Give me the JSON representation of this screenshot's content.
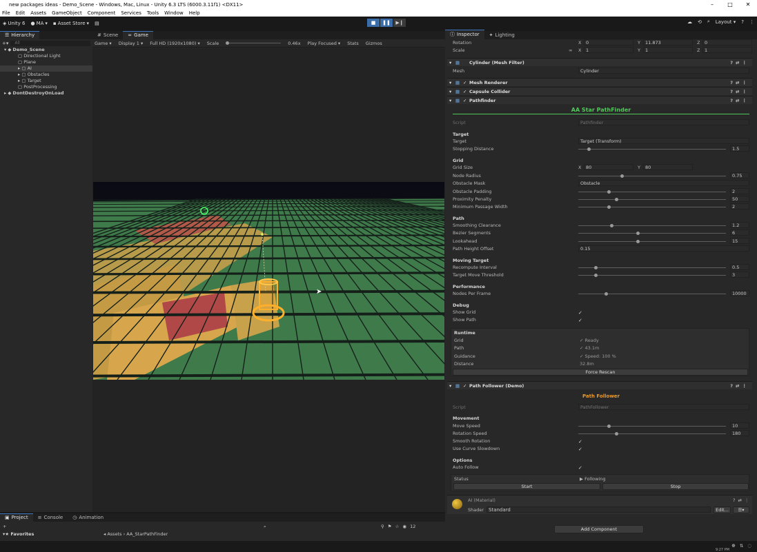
{
  "window": {
    "title": "new packages ideas - Demo_Scene - Windows, Mac, Linux - Unity 6.3 LTS (6000.3.11f1) <DX11>",
    "min": "–",
    "max": "□",
    "close": "✕"
  },
  "menu": [
    "File",
    "Edit",
    "Assets",
    "GameObject",
    "Component",
    "Services",
    "Tools",
    "Window",
    "Help"
  ],
  "toolbar": {
    "unity": "Unity 6",
    "account": "MA",
    "store": "Asset Store",
    "layout": "Layout"
  },
  "hierarchy": {
    "tab": "Hierarchy",
    "search_placeholder": "All",
    "items": [
      {
        "label": "Demo_Scene",
        "depth": 0
      },
      {
        "label": "Directional Light",
        "depth": 2
      },
      {
        "label": "Plane",
        "depth": 2
      },
      {
        "label": "AI",
        "depth": 2
      },
      {
        "label": "Obstacles",
        "depth": 2
      },
      {
        "label": "Target",
        "depth": 2
      },
      {
        "label": "PostProcessing",
        "depth": 2
      },
      {
        "label": "DontDestroyOnLoad",
        "depth": 0
      }
    ]
  },
  "view_tabs": {
    "scene": "Scene",
    "game": "Game"
  },
  "gamebar": {
    "mode": "Game",
    "display": "Display 1",
    "resolution": "Full HD (1920x1080)",
    "scale_label": "Scale",
    "scale_value": "0.46x",
    "play_mode": "Play Focused",
    "stats": "Stats",
    "gizmos": "Gizmos"
  },
  "bottom": {
    "tabs": [
      "Project",
      "Console",
      "Animation"
    ],
    "favorites": "Favorites",
    "breadcrumb_root": "Assets",
    "breadcrumb_folder": "AA_StarPathFinder",
    "count": "12"
  },
  "inspector": {
    "tabs": [
      "Inspector",
      "Lighting"
    ],
    "transform": {
      "rotation_label": "Rotation",
      "scale_label": "Scale",
      "rot": [
        "0",
        "11.873",
        "0"
      ],
      "scale": [
        "1",
        "1",
        "1"
      ]
    },
    "mesh_filter": {
      "title": "Cylinder (Mesh Filter)",
      "mesh_label": "Mesh",
      "mesh_value": "Cylinder"
    },
    "mesh_renderer": "Mesh Renderer",
    "capsule_collider": "Capsule Collider",
    "pathfinder": {
      "title": "Pathfinder",
      "banner": "AA Star PathFinder",
      "script_label": "Script",
      "script_value": "Pathfinder",
      "target_hdr": "Target",
      "target_label": "Target",
      "target_value": "Target (Transform)",
      "stopping_label": "Stopping Distance",
      "stopping": "1.5",
      "stopping_frac": 0.06,
      "grid_hdr": "Grid",
      "gridsize_label": "Grid Size",
      "grid_x": "80",
      "grid_y": "80",
      "rows": [
        {
          "label": "Node Radius",
          "value": "0.75",
          "frac": 0.29
        },
        {
          "label": "Obstacle Mask",
          "value": "Obstacle",
          "type": "dropdown"
        },
        {
          "label": "Obstacle Padding",
          "value": "2",
          "frac": 0.2
        },
        {
          "label": "Proximity Penalty",
          "value": "50",
          "frac": 0.25
        },
        {
          "label": "Minimum Passage Width",
          "value": "2",
          "frac": 0.2
        }
      ],
      "path_hdr": "Path",
      "path_rows": [
        {
          "label": "Smoothing Clearance",
          "value": "1.2",
          "frac": 0.22
        },
        {
          "label": "Bezier Segments",
          "value": "6",
          "frac": 0.4
        },
        {
          "label": "Lookahead",
          "value": "15",
          "frac": 0.4
        },
        {
          "label": "Path Height Offset",
          "value": "0.15",
          "type": "field"
        }
      ],
      "moving_hdr": "Moving Target",
      "moving_rows": [
        {
          "label": "Recompute Interval",
          "value": "0.5",
          "frac": 0.11
        },
        {
          "label": "Target Move Threshold",
          "value": "3",
          "frac": 0.11
        }
      ],
      "perf_hdr": "Performance",
      "perf_label": "Nodes Per Frame",
      "perf_value": "10000",
      "perf_frac": 0.18,
      "debug_hdr": "Debug",
      "show_grid": "Show Grid",
      "show_path": "Show Path",
      "runtime_hdr": "Runtime",
      "runtime": [
        {
          "label": "Grid",
          "value": "✓ Ready"
        },
        {
          "label": "Path",
          "value": "✓ 43.1m"
        },
        {
          "label": "Guidance",
          "value": "✓ Speed: 100 %"
        },
        {
          "label": "Distance",
          "value": "32.8m"
        }
      ],
      "force_rescan": "Force Rescan"
    },
    "follower": {
      "title": "Path Follower (Demo)",
      "banner": "Path Follower",
      "script_label": "Script",
      "script_value": "PathFollower",
      "movement_hdr": "Movement",
      "move_speed_label": "Move Speed",
      "move_speed": "10",
      "move_frac": 0.2,
      "rot_speed_label": "Rotation Speed",
      "rot_speed": "180",
      "rot_frac": 0.25,
      "smooth_rot": "Smooth Rotation",
      "curve_slow": "Use Curve Slowdown",
      "options_hdr": "Options",
      "auto_follow": "Auto Follow",
      "status_label": "Status",
      "status_value": "▶ Following",
      "start": "Start",
      "stop": "Stop"
    },
    "material": {
      "name": "AI (Material)",
      "shader_label": "Shader",
      "shader_value": "Standard",
      "edit": "Edit..."
    },
    "add_component": "Add Component"
  },
  "status": {
    "time": "9:27 PM"
  },
  "colors": {
    "accent_blue": "#3d78c0",
    "banner_green": "#4fc85a",
    "banner_orange": "#e89a2c"
  }
}
